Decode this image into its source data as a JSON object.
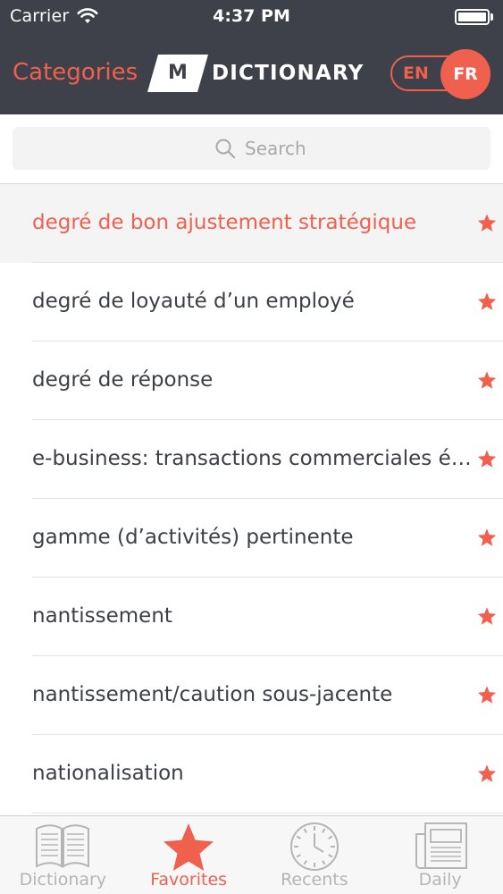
{
  "status_bar": {
    "carrier": "Carrier",
    "time": "4:37 PM"
  },
  "nav": {
    "categories_label": "Categories",
    "logo_letter": "M",
    "logo_word": "DICTIONARY",
    "lang_en": "EN",
    "lang_fr": "FR",
    "active_lang": "FR"
  },
  "search": {
    "placeholder": "Search",
    "value": ""
  },
  "list": {
    "items": [
      {
        "term": "degré de bon ajustement stratégique",
        "selected": true,
        "favorite": true
      },
      {
        "term": "degré de loyauté d’un employé",
        "selected": false,
        "favorite": true
      },
      {
        "term": "degré de réponse",
        "selected": false,
        "favorite": true
      },
      {
        "term": "e-business: transactions commerciales électroniques",
        "selected": false,
        "favorite": true
      },
      {
        "term": "gamme (d’activités) pertinente",
        "selected": false,
        "favorite": true
      },
      {
        "term": "nantissement",
        "selected": false,
        "favorite": true
      },
      {
        "term": "nantissement/caution sous-jacente",
        "selected": false,
        "favorite": true
      },
      {
        "term": "nationalisation",
        "selected": false,
        "favorite": true
      }
    ]
  },
  "tabbar": {
    "tabs": [
      {
        "label": "Dictionary",
        "icon": "book-icon",
        "active": false
      },
      {
        "label": "Favorites",
        "icon": "star-icon",
        "active": true
      },
      {
        "label": "Recents",
        "icon": "clock-icon",
        "active": false
      },
      {
        "label": "Daily",
        "icon": "newspaper-icon",
        "active": false
      }
    ]
  },
  "colors": {
    "accent": "#f0604f",
    "header_bg": "#3e4149",
    "text": "#3c3f45",
    "inactive_tab": "#b5b5b5"
  }
}
